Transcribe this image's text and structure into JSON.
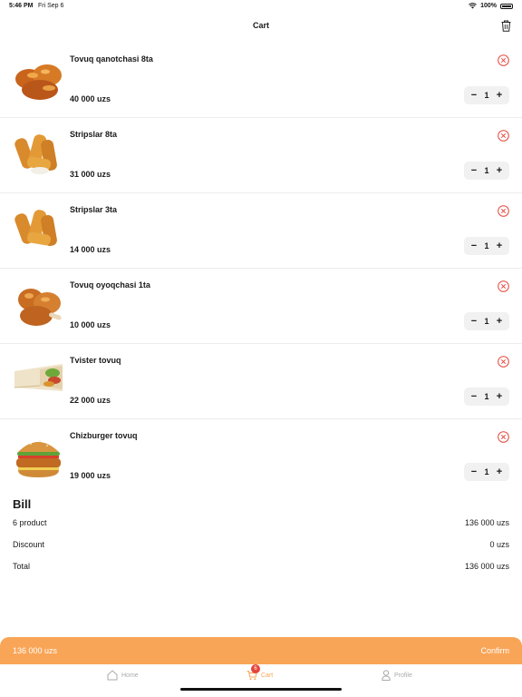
{
  "status": {
    "time": "5:46 PM",
    "date": "Fri Sep 6",
    "battery": "100%"
  },
  "header": {
    "title": "Cart"
  },
  "items": [
    {
      "name": "Tovuq qanotchasi 8ta",
      "price": "40 000 uzs",
      "qty": "1",
      "image": "fried-chicken-wings"
    },
    {
      "name": "Stripslar 8ta",
      "price": "31 000 uzs",
      "qty": "1",
      "image": "chicken-strips"
    },
    {
      "name": "Stripslar 3ta",
      "price": "14 000 uzs",
      "qty": "1",
      "image": "chicken-strips"
    },
    {
      "name": "Tovuq oyoqchasi 1ta",
      "price": "10 000 uzs",
      "qty": "1",
      "image": "chicken-drumsticks"
    },
    {
      "name": "Tvister tovuq",
      "price": "22 000 uzs",
      "qty": "1",
      "image": "chicken-twister-wrap"
    },
    {
      "name": "Chizburger tovuq",
      "price": "19 000 uzs",
      "qty": "1",
      "image": "chicken-burger"
    }
  ],
  "stepper": {
    "minus": "−",
    "plus": "+"
  },
  "bill": {
    "title": "Bill",
    "rows": [
      {
        "label": "6 product",
        "value": "136 000 uzs"
      },
      {
        "label": "Discount",
        "value": "0 uzs"
      },
      {
        "label": "Total",
        "value": "136 000 uzs"
      }
    ]
  },
  "confirm_bar": {
    "total": "136 000 uzs",
    "confirm_label": "Confirm",
    "color": "#f9a557"
  },
  "tabs": [
    {
      "label": "Home",
      "icon": "home-icon"
    },
    {
      "label": "Cart",
      "icon": "cart-icon",
      "badge": "6",
      "active": true
    },
    {
      "label": "Profile",
      "icon": "person-icon"
    }
  ],
  "colors": {
    "accent": "#f9a557",
    "danger": "#e6453b"
  }
}
